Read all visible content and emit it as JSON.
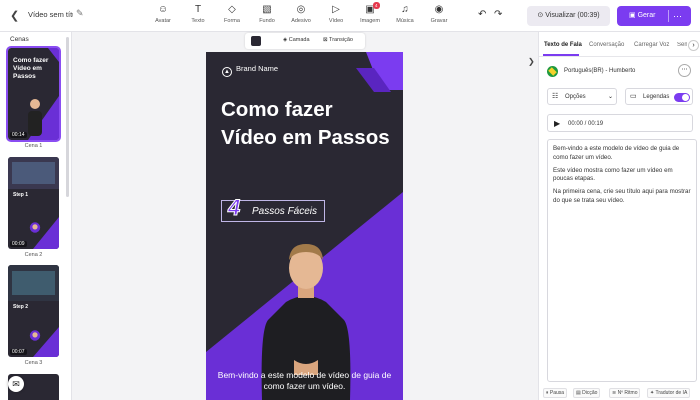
{
  "topbar": {
    "back_icon": "chevron-left-icon",
    "project_title": "Vídeo sem títu...",
    "tools": [
      {
        "label": "Avatar",
        "icon": "avatar-icon",
        "glyph": "☺"
      },
      {
        "label": "Texto",
        "icon": "text-icon",
        "glyph": "T"
      },
      {
        "label": "Forma",
        "icon": "shape-icon",
        "glyph": "◇"
      },
      {
        "label": "Fundo",
        "icon": "background-icon",
        "glyph": "▧"
      },
      {
        "label": "Adesivo",
        "icon": "sticker-icon",
        "glyph": "◎"
      },
      {
        "label": "Vídeo",
        "icon": "video-icon",
        "glyph": "▷"
      },
      {
        "label": "Imagem",
        "icon": "image-icon",
        "glyph": "▣",
        "badge": "4"
      },
      {
        "label": "Música",
        "icon": "music-icon",
        "glyph": "♫"
      },
      {
        "label": "Gravar",
        "icon": "record-icon",
        "glyph": "◉"
      }
    ],
    "preview_label": "Visualizar (00:39)",
    "generate_label": "Gerar",
    "accent_color": "#7b3cf0"
  },
  "scenes": {
    "title": "Cenas",
    "items": [
      {
        "label": "Cena 1",
        "duration": "00:14",
        "headline": "Como fazer Vídeo em Passos",
        "active": true
      },
      {
        "label": "Cena 2",
        "duration": "00:09",
        "headline": "Step 1"
      },
      {
        "label": "Cena 3",
        "duration": "00:07",
        "headline": "Step 2"
      }
    ]
  },
  "canvas_toolbar": {
    "camada": "Camada",
    "transicao": "Transição"
  },
  "video": {
    "brand": "Brand Name",
    "headline": "Como fazer Vídeo em Passos",
    "steps_number": "4",
    "steps_text": "Passos Fáceis",
    "caption": "Bem-vindo a este modelo de vídeo de guia de como fazer um vídeo."
  },
  "right_panel": {
    "tabs": [
      "Texto de Fala",
      "Conversação",
      "Carregar Voz",
      "Sem"
    ],
    "voice_name": "Português(BR) - Humberto",
    "options_label": "Opções",
    "subtitles_label": "Legendas",
    "player_time": "00:00 / 00:19",
    "script": [
      "Bem-vindo a este modelo de vídeo de guia de como fazer um vídeo.",
      "Este vídeo mostra como fazer um vídeo em poucas etapas.",
      "Na primeira cena, crie seu título aqui para mostrar do que se trata seu vídeo."
    ],
    "bottom_tools": [
      "Pausa",
      "Dicção",
      "Nº Ritmo",
      "Tradutor de IA"
    ]
  }
}
